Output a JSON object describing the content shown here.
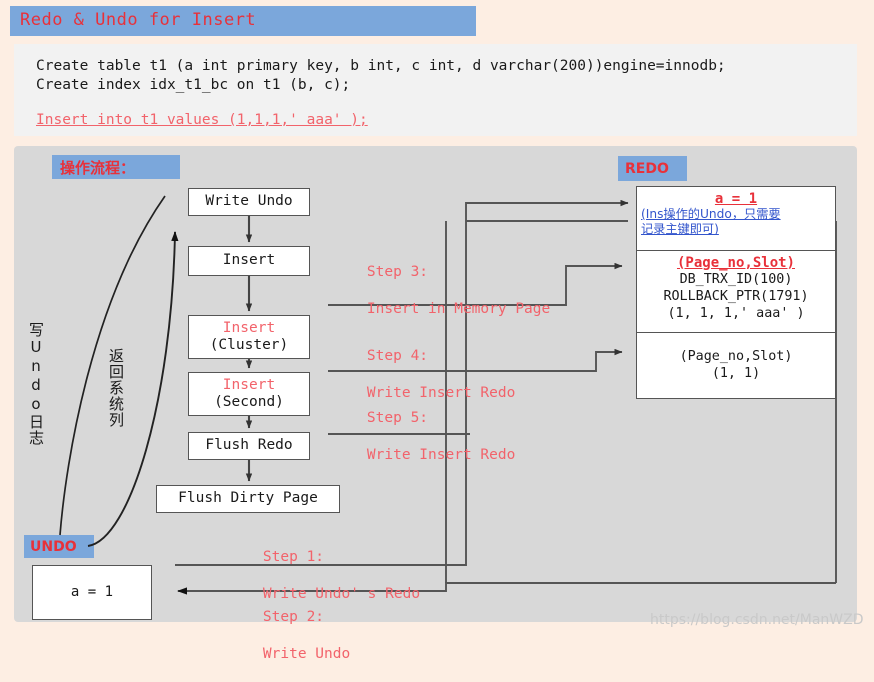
{
  "header": {
    "title": "Redo & Undo for Insert",
    "band_color": "#7ba7db",
    "title_color": "#e8313a"
  },
  "code_block": {
    "line1": "Create table t1 (a int primary key, b int, c int, d varchar(200))engine=innodb;",
    "line2": "Create index idx_t1_bc on t1 (b, c);",
    "highlight": "Insert into t1 values (1,1,1,' aaa' );",
    "highlight_color": "#f2636b"
  },
  "panel": {
    "flow_tag": "操作流程：",
    "redo_tag": "REDO",
    "undo_tag": "UNDO",
    "boxes": {
      "write_undo": "Write Undo",
      "insert": "Insert",
      "insert_cluster_top": "Insert",
      "insert_cluster_bottom": "(Cluster)",
      "insert_second_top": "Insert",
      "insert_second_bottom": "(Second)",
      "flush_redo": "Flush Redo",
      "flush_dirty_page": "Flush Dirty Page",
      "undo_record": "a = 1"
    },
    "vertical_labels": {
      "write_undo_log": "写Undo日志",
      "return_system": "返回系统列"
    },
    "steps": [
      {
        "id": "step1",
        "title": "Step 1:",
        "text": "Write Undo' s Redo"
      },
      {
        "id": "step2",
        "title": "Step 2:",
        "text": "Write Undo"
      },
      {
        "id": "step3",
        "title": "Step 3:",
        "text": "Insert in Memory Page"
      },
      {
        "id": "step4",
        "title": "Step 4:",
        "text": "Write Insert Redo"
      },
      {
        "id": "step5",
        "title": "Step 5:",
        "text": "Write Insert Redo"
      }
    ],
    "redo_entries": [
      {
        "title": "a = 1",
        "note": "(Ins操作的Undo，只需要\n记录主键即可)",
        "lines": []
      },
      {
        "title": "(Page_no,Slot)",
        "note": "",
        "lines": [
          "DB_TRX_ID(100)",
          "ROLLBACK_PTR(1791)",
          "(1, 1, 1,' aaa' )"
        ]
      },
      {
        "title": "",
        "note": "",
        "lines": [
          "(Page_no,Slot)",
          "(1, 1)"
        ]
      }
    ]
  },
  "watermark": "https://blog.csdn.net/ManWZD",
  "colors": {
    "page_bg": "#fdeee3",
    "panel_bg": "#d8d8d8",
    "code_bg": "#f2f2f2",
    "accent_blue": "#7ba7db",
    "accent_red": "#e8313a",
    "soft_red": "#f2636b",
    "link_blue": "#3355cc"
  }
}
